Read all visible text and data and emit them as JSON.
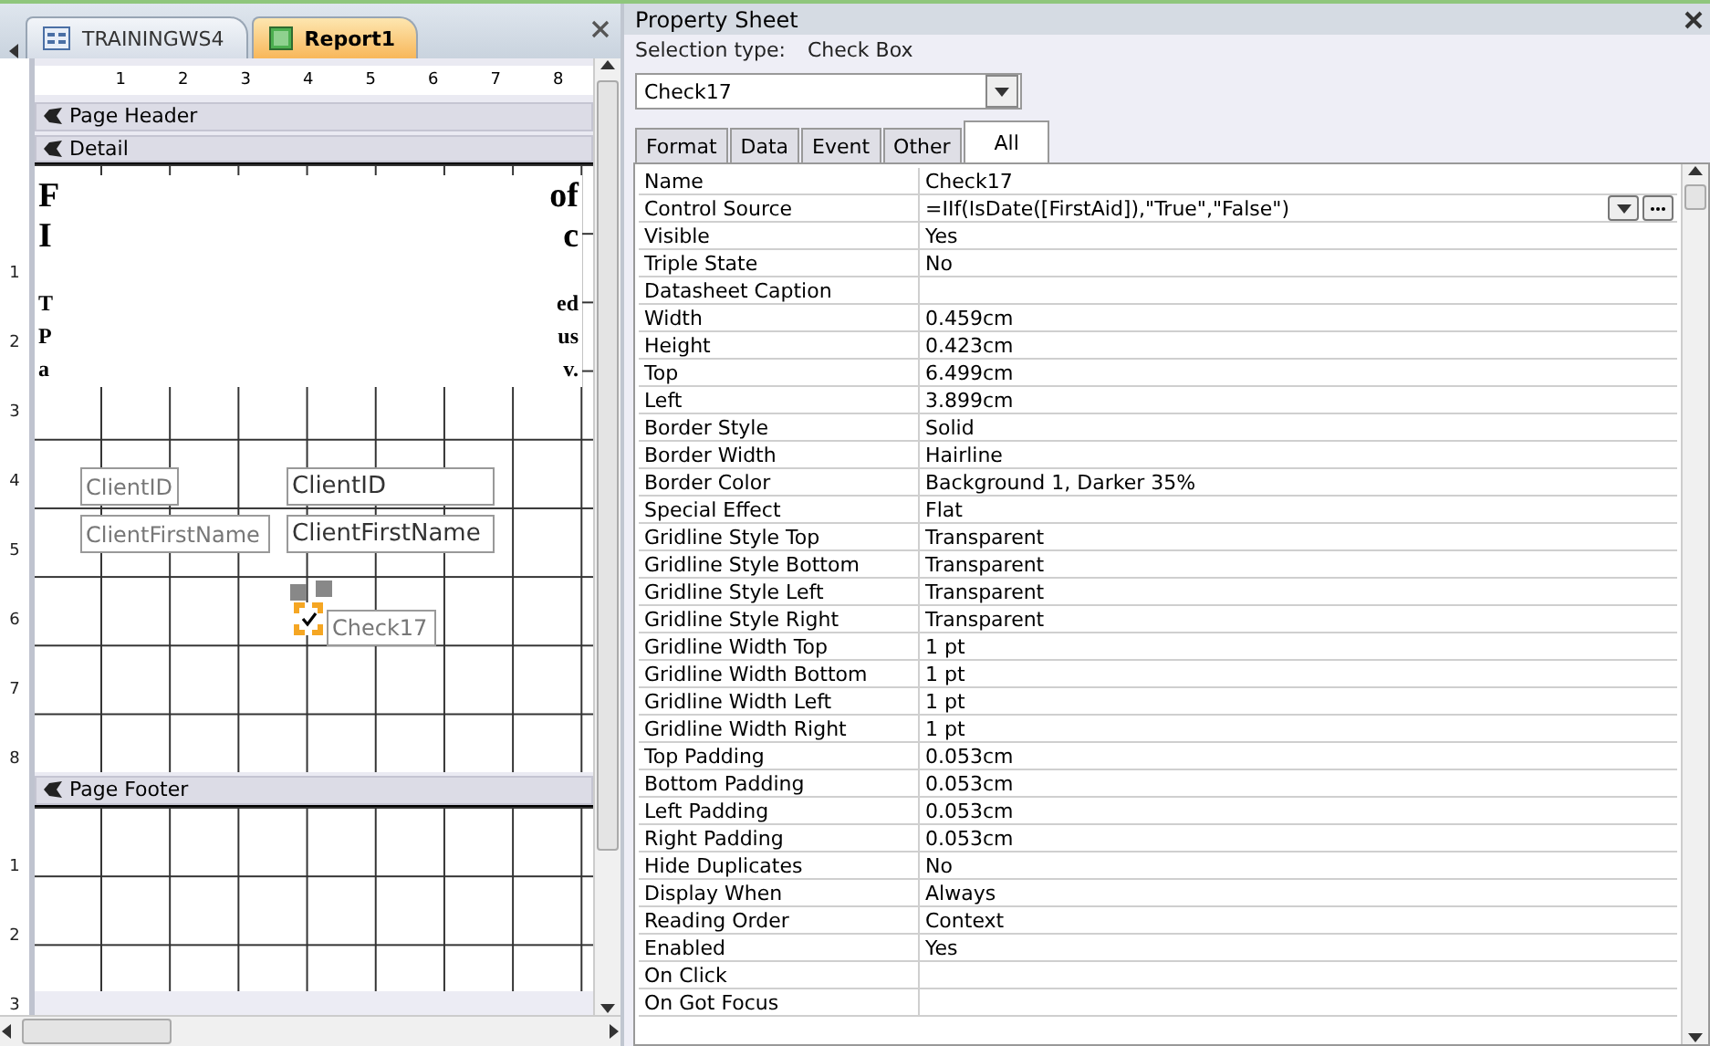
{
  "doc_tabs": [
    {
      "label": "TRAININGWS4",
      "kind": "form",
      "selected": false
    },
    {
      "label": "Report1",
      "kind": "report",
      "selected": true
    }
  ],
  "ruler": {
    "marks": [
      "1",
      "2",
      "3",
      "4",
      "5",
      "6",
      "7",
      "8"
    ]
  },
  "sections": [
    {
      "title": "Page Header",
      "kind": "empty"
    },
    {
      "title": "Detail",
      "kind": "detail",
      "ruler": [
        "1",
        "2",
        "3",
        "4",
        "5",
        "6",
        "7",
        "8"
      ]
    },
    {
      "title": "Page Footer",
      "kind": "footer",
      "ruler": [
        "1",
        "2",
        "3"
      ]
    }
  ],
  "header_text": {
    "big_left": [
      "F",
      "I"
    ],
    "big_right": [
      "of",
      "c"
    ],
    "small_left": [
      "T",
      "P",
      "a"
    ],
    "small_right": [
      "ed",
      "us",
      "v."
    ]
  },
  "controls": [
    {
      "kind": "label",
      "text": "ClientID"
    },
    {
      "kind": "textbox",
      "text": "ClientID"
    },
    {
      "kind": "label",
      "text": "ClientFirstName"
    },
    {
      "kind": "textbox",
      "text": "ClientFirstName"
    },
    {
      "kind": "checkbox",
      "checked": true,
      "selected": true
    },
    {
      "kind": "label",
      "text": "Check17"
    }
  ],
  "property_sheet": {
    "title": "Property Sheet",
    "selection_label": "Selection type:",
    "selection_type": "Check Box",
    "object": "Check17",
    "tabs": [
      {
        "label": "Format",
        "selected": false
      },
      {
        "label": "Data",
        "selected": false
      },
      {
        "label": "Event",
        "selected": false
      },
      {
        "label": "Other",
        "selected": false
      },
      {
        "label": "All",
        "selected": true
      }
    ],
    "rows": [
      {
        "name": "Name",
        "value": "Check17"
      },
      {
        "name": "Control Source",
        "value": "=IIf(IsDate([FirstAid]),\"True\",\"False\")",
        "has_buttons": true
      },
      {
        "name": "Visible",
        "value": "Yes"
      },
      {
        "name": "Triple State",
        "value": "No"
      },
      {
        "name": "Datasheet Caption",
        "value": ""
      },
      {
        "name": "Width",
        "value": "0.459cm"
      },
      {
        "name": "Height",
        "value": "0.423cm"
      },
      {
        "name": "Top",
        "value": "6.499cm"
      },
      {
        "name": "Left",
        "value": "3.899cm"
      },
      {
        "name": "Border Style",
        "value": "Solid"
      },
      {
        "name": "Border Width",
        "value": "Hairline"
      },
      {
        "name": "Border Color",
        "value": "Background 1, Darker 35%"
      },
      {
        "name": "Special Effect",
        "value": "Flat"
      },
      {
        "name": "Gridline Style Top",
        "value": "Transparent"
      },
      {
        "name": "Gridline Style Bottom",
        "value": "Transparent"
      },
      {
        "name": "Gridline Style Left",
        "value": "Transparent"
      },
      {
        "name": "Gridline Style Right",
        "value": "Transparent"
      },
      {
        "name": "Gridline Width Top",
        "value": "1 pt"
      },
      {
        "name": "Gridline Width Bottom",
        "value": "1 pt"
      },
      {
        "name": "Gridline Width Left",
        "value": "1 pt"
      },
      {
        "name": "Gridline Width Right",
        "value": "1 pt"
      },
      {
        "name": "Top Padding",
        "value": "0.053cm"
      },
      {
        "name": "Bottom Padding",
        "value": "0.053cm"
      },
      {
        "name": "Left Padding",
        "value": "0.053cm"
      },
      {
        "name": "Right Padding",
        "value": "0.053cm"
      },
      {
        "name": "Hide Duplicates",
        "value": "No"
      },
      {
        "name": "Display When",
        "value": "Always"
      },
      {
        "name": "Reading Order",
        "value": "Context"
      },
      {
        "name": "Enabled",
        "value": "Yes"
      },
      {
        "name": "On Click",
        "value": ""
      },
      {
        "name": "On Got Focus",
        "value": ""
      }
    ]
  }
}
